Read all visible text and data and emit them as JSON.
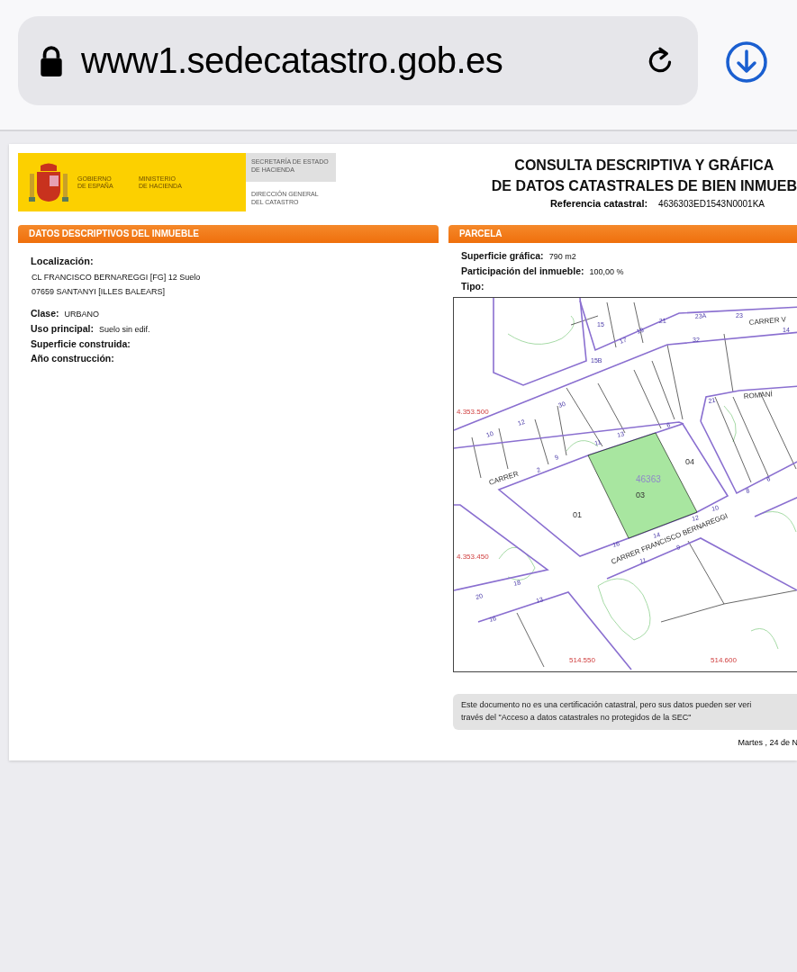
{
  "browser": {
    "url": "www1.sedecatastro.gob.es"
  },
  "header": {
    "logo": [
      [
        "GOBIERNO",
        "DE ESPAÑA"
      ],
      [
        "MINISTERIO",
        "DE HACIENDA"
      ]
    ],
    "secretaria": [
      "SECRETARÍA DE ESTADO",
      "DE HACIENDA"
    ],
    "direccion": [
      "DIRECCIÓN GENERAL",
      "DEL CATASTRO"
    ],
    "title": [
      "CONSULTA DESCRIPTIVA Y GRÁFICA",
      "DE DATOS CATASTRALES DE BIEN INMUEB"
    ],
    "reference": {
      "label": "Referencia catastral:",
      "value": "4636303ED1543N0001KA"
    }
  },
  "left_section": {
    "title": "DATOS DESCRIPTIVOS DEL INMUEBLE",
    "fields": [
      {
        "kind": "block",
        "label": "Localización:",
        "lines": [
          "CL FRANCISCO BERNAREGGI [FG] 12 Suelo",
          "07659 SANTANYI [ILLES BALEARS]"
        ]
      },
      {
        "kind": "inline",
        "label": "Clase:",
        "value": "URBANO"
      },
      {
        "kind": "inline",
        "label": "Uso principal:",
        "value": "Suelo sin edif."
      },
      {
        "kind": "inline",
        "label": "Superficie construida:"
      },
      {
        "kind": "inline",
        "label": "Año construcción:"
      }
    ]
  },
  "right_section": {
    "title": "PARCELA",
    "fields": [
      {
        "kind": "inline",
        "label": "Superficie gráfica:",
        "value": "790 m2"
      },
      {
        "kind": "inline",
        "label": "Participación del inmueble:",
        "value": "100,00 %"
      },
      {
        "kind": "inline",
        "label": "Tipo:"
      }
    ],
    "map": {
      "labels": [
        {
          "kind": "parcel",
          "text": "46363"
        },
        {
          "kind": "subparcel",
          "text": "03"
        },
        {
          "kind": "subparcel",
          "text": "01"
        },
        {
          "kind": "subparcel",
          "text": "04"
        },
        {
          "kind": "coordinate",
          "text": "4.353.500"
        },
        {
          "kind": "coordinate",
          "text": "4.353.450"
        },
        {
          "kind": "coordinate",
          "text": "514.550"
        },
        {
          "kind": "coordinate",
          "text": "514.600"
        },
        {
          "kind": "street",
          "text": "CARRER FRANCISCO BERNAREGGI"
        },
        {
          "kind": "street",
          "text": "CARRER"
        },
        {
          "kind": "street",
          "text": "CARRER V"
        },
        {
          "kind": "street",
          "text": "ROMANÍ"
        },
        {
          "kind": "number",
          "text": "15"
        },
        {
          "kind": "number",
          "text": "21"
        },
        {
          "kind": "number",
          "text": "23A"
        },
        {
          "kind": "number",
          "text": "23"
        },
        {
          "kind": "number",
          "text": "19"
        },
        {
          "kind": "number",
          "text": "17"
        },
        {
          "kind": "number",
          "text": "15B"
        },
        {
          "kind": "number",
          "text": "32"
        },
        {
          "kind": "number",
          "text": "14"
        },
        {
          "kind": "number",
          "text": "30"
        },
        {
          "kind": "number",
          "text": "12"
        },
        {
          "kind": "number",
          "text": "10"
        },
        {
          "kind": "number",
          "text": "11"
        },
        {
          "kind": "number",
          "text": "13"
        },
        {
          "kind": "number",
          "text": "6"
        },
        {
          "kind": "number",
          "text": "9"
        },
        {
          "kind": "number",
          "text": "2"
        },
        {
          "kind": "number",
          "text": "21"
        },
        {
          "kind": "number",
          "text": "12"
        },
        {
          "kind": "number",
          "text": "14"
        },
        {
          "kind": "number",
          "text": "16"
        },
        {
          "kind": "number",
          "text": "11"
        },
        {
          "kind": "number",
          "text": "9"
        },
        {
          "kind": "number",
          "text": "20"
        },
        {
          "kind": "number",
          "text": "18"
        },
        {
          "kind": "number",
          "text": "13"
        },
        {
          "kind": "number",
          "text": "16"
        },
        {
          "kind": "number",
          "text": "10"
        },
        {
          "kind": "number",
          "text": "8"
        },
        {
          "kind": "number",
          "text": "6"
        }
      ]
    },
    "note": [
      "Este documento no es una certificación catastral, pero sus datos pueden ser veri",
      "través del \"Acceso a datos catastrales no protegidos de la SEC\""
    ],
    "date": "Martes , 24 de N"
  }
}
